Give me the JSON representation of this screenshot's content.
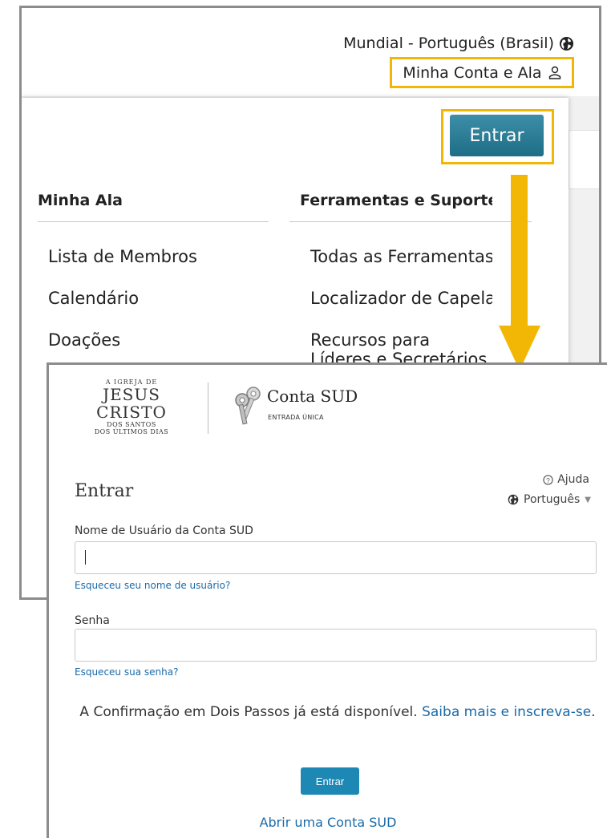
{
  "colors": {
    "highlight": "#f2b705",
    "button": "#1e88b4",
    "link": "#1a6aa8"
  },
  "header": {
    "region_label": "Mundial - Português (Brasil)",
    "region_icon": "globe-icon",
    "account_label": "Minha Conta e Ala",
    "account_icon": "user-icon"
  },
  "dropdown": {
    "signin_label": "Entrar",
    "columns": [
      {
        "heading": "Minha Ala",
        "items": [
          "Lista de Membros",
          "Calendário",
          "Doações"
        ]
      },
      {
        "heading": "Ferramentas e Suporte",
        "items": [
          "Todas as Ferramentas",
          "Localizador de Capelas",
          "Recursos para Líderes e Secretários"
        ]
      }
    ]
  },
  "login": {
    "logo": {
      "top": "A IGREJA DE",
      "main": "JESUS CRISTO",
      "sub1": "DOS SANTOS",
      "sub2": "DOS ÚLTIMOS DIAS"
    },
    "product_name": "Conta SUD",
    "product_subtitle": "ENTRADA ÚNICA",
    "help_label": "Ajuda",
    "language_label": "Português",
    "title": "Entrar",
    "username_label": "Nome de Usuário da Conta SUD",
    "username_value": "",
    "forgot_username": "Esqueceu seu nome de usuário?",
    "password_label": "Senha",
    "password_value": "",
    "forgot_password": "Esqueceu sua senha?",
    "twostep_text": "A Confirmação em Dois Passos já está disponível.",
    "twostep_link": "Saiba mais e inscreva-se",
    "submit_label": "Entrar",
    "create_account": "Abrir uma Conta SUD"
  }
}
